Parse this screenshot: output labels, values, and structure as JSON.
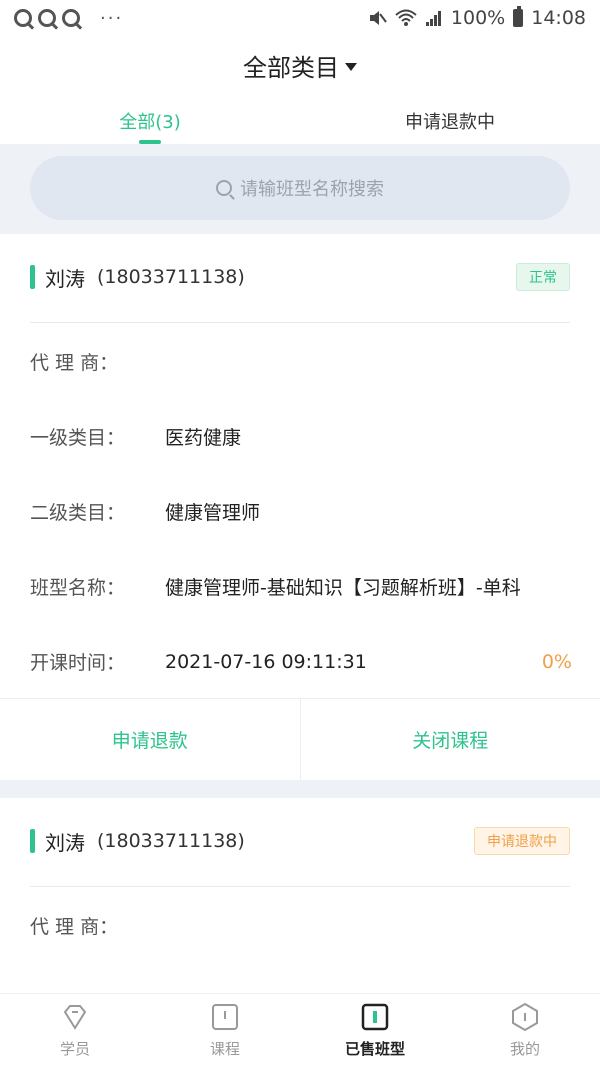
{
  "status_bar": {
    "battery": "100%",
    "time": "14:08",
    "dots": "···"
  },
  "header": {
    "title": "全部类目"
  },
  "tabs": [
    {
      "label": "全部(3)"
    },
    {
      "label": "申请退款中"
    }
  ],
  "search": {
    "placeholder": "请输班型名称搜索"
  },
  "cards": [
    {
      "name": "刘涛",
      "phone": "(18033711138)",
      "status": "正常",
      "agent_label": "代 理 商：",
      "agent_value": "",
      "cat1_label": "一级类目：",
      "cat1_value": "医药健康",
      "cat2_label": "二级类目：",
      "cat2_value": "健康管理师",
      "class_label": "班型名称：",
      "class_value": "健康管理师-基础知识【习题解析班】-单科",
      "time_label": "开课时间：",
      "time_value": "2021-07-16 09:11:31",
      "progress": "0%",
      "action_refund": "申请退款",
      "action_close": "关闭课程"
    },
    {
      "name": "刘涛",
      "phone": "(18033711138)",
      "status": "申请退款中",
      "agent_label": "代 理 商："
    }
  ],
  "bottom_nav": [
    {
      "label": "学员"
    },
    {
      "label": "课程"
    },
    {
      "label": "已售班型"
    },
    {
      "label": "我的"
    }
  ],
  "colors": {
    "accent": "#2ec38d",
    "warning": "#f0a04b",
    "band": "#eef2f7"
  }
}
